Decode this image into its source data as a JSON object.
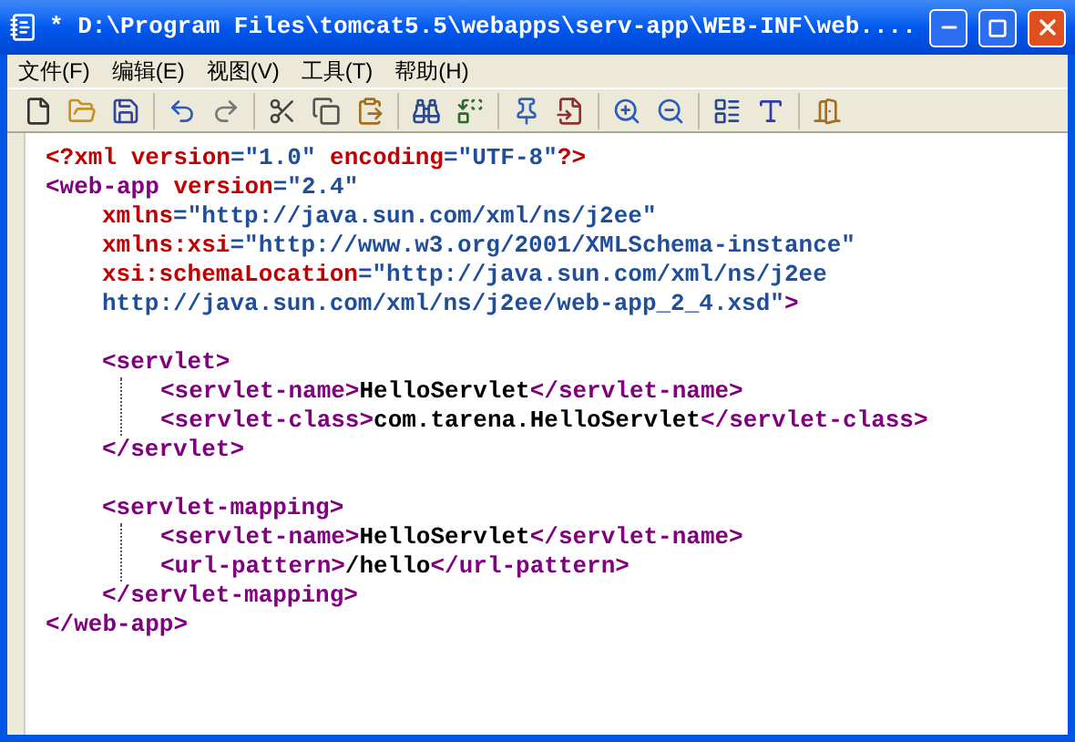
{
  "window": {
    "title": "* D:\\Program Files\\tomcat5.5\\webapps\\serv-app\\WEB-INF\\web...."
  },
  "menu": [
    {
      "label": "文件(F)"
    },
    {
      "label": "编辑(E)"
    },
    {
      "label": "视图(V)"
    },
    {
      "label": "工具(T)"
    },
    {
      "label": "帮助(H)"
    }
  ],
  "lines": [
    {
      "kind": "code",
      "tokens": [
        {
          "kind": "pi",
          "text": "<?xml"
        },
        {
          "kind": "attr",
          "text": " version"
        },
        {
          "kind": "value",
          "text": "=\"1.0\""
        },
        {
          "kind": "attr",
          "text": " encoding"
        },
        {
          "kind": "value",
          "text": "=\"UTF-8\""
        },
        {
          "kind": "pi",
          "text": "?>"
        }
      ]
    },
    {
      "kind": "code",
      "tokens": [
        {
          "kind": "tag",
          "text": "<web-app"
        },
        {
          "kind": "attr",
          "text": " version"
        },
        {
          "kind": "value",
          "text": "=\"2.4\""
        }
      ],
      "children": [
        {
          "kind": "code",
          "tokens": [
            {
              "kind": "attr",
              "text": "xmlns"
            },
            {
              "kind": "value",
              "text": "=\"http://java.sun.com/xml/ns/j2ee\""
            }
          ]
        },
        {
          "kind": "code",
          "tokens": [
            {
              "kind": "attr",
              "text": "xmlns:xsi"
            },
            {
              "kind": "value",
              "text": "=\"http://www.w3.org/2001/XMLSchema-instance\""
            }
          ]
        },
        {
          "kind": "code",
          "tokens": [
            {
              "kind": "attr",
              "text": "xsi:schemaLocation"
            },
            {
              "kind": "value",
              "text": "=\"http://java.sun.com/xml/ns/j2ee"
            }
          ]
        },
        {
          "kind": "code",
          "tokens": [
            {
              "kind": "value",
              "text": "http://java.sun.com/xml/ns/j2ee/web-app_2_4.xsd\""
            },
            {
              "kind": "tag",
              "text": ">"
            }
          ]
        },
        {
          "kind": "blank"
        },
        {
          "kind": "code",
          "tokens": [
            {
              "kind": "tag",
              "text": "<servlet>"
            }
          ],
          "children": [
            {
              "kind": "code",
              "tokens": [
                {
                  "kind": "tag",
                  "text": "<servlet-name>"
                },
                {
                  "kind": "text",
                  "text": "HelloServlet"
                },
                {
                  "kind": "tag",
                  "text": "</servlet-name>"
                }
              ]
            },
            {
              "kind": "code",
              "tokens": [
                {
                  "kind": "tag",
                  "text": "<servlet-class>"
                },
                {
                  "kind": "text",
                  "text": "com.tarena.HelloServlet"
                },
                {
                  "kind": "tag",
                  "text": "</servlet-class>"
                }
              ]
            }
          ]
        },
        {
          "kind": "code",
          "tokens": [
            {
              "kind": "tag",
              "text": "</servlet>"
            }
          ]
        },
        {
          "kind": "blank"
        },
        {
          "kind": "code",
          "tokens": [
            {
              "kind": "tag",
              "text": "<servlet-mapping>"
            }
          ],
          "children": [
            {
              "kind": "code",
              "tokens": [
                {
                  "kind": "tag",
                  "text": "<servlet-name>"
                },
                {
                  "kind": "text",
                  "text": "HelloServlet"
                },
                {
                  "kind": "tag",
                  "text": "</servlet-name>"
                }
              ]
            },
            {
              "kind": "code",
              "tokens": [
                {
                  "kind": "tag",
                  "text": "<url-pattern>"
                },
                {
                  "kind": "text",
                  "text": "/hello"
                },
                {
                  "kind": "tag",
                  "text": "</url-pattern>"
                }
              ]
            }
          ]
        },
        {
          "kind": "code",
          "tokens": [
            {
              "kind": "tag",
              "text": "</servlet-mapping>"
            }
          ]
        }
      ]
    },
    {
      "kind": "code",
      "tokens": [
        {
          "kind": "tag",
          "text": "</web-app>"
        }
      ]
    }
  ]
}
